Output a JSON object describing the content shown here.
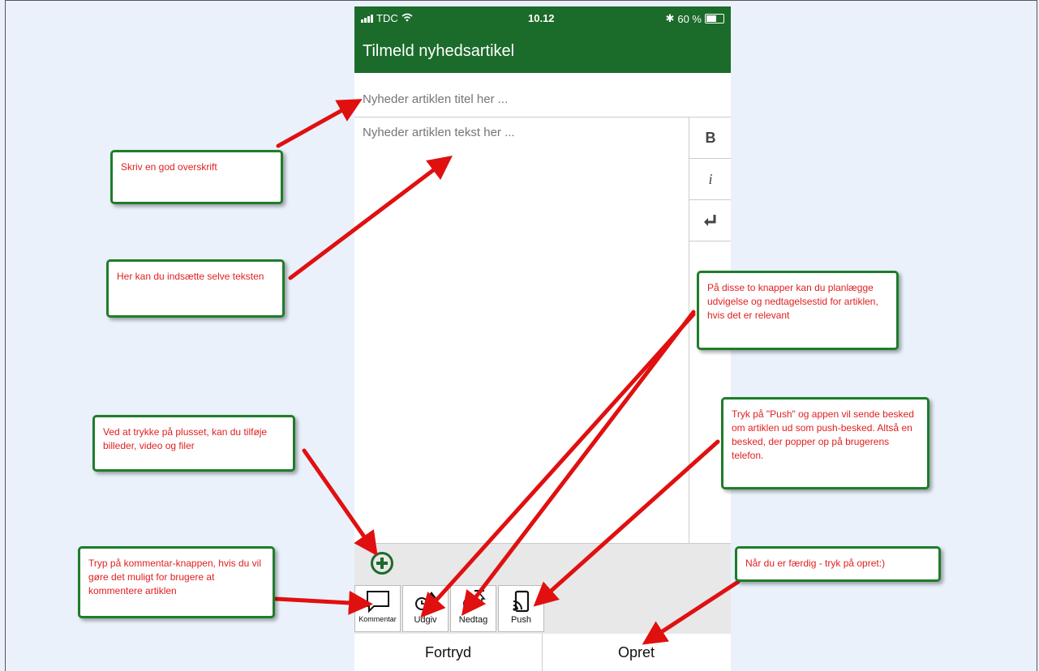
{
  "status_bar": {
    "carrier": "TDC",
    "time": "10.12",
    "battery": "60 %"
  },
  "app_bar": {
    "title": "Tilmeld nyhedsartikel"
  },
  "form": {
    "title_placeholder": "Nyheder artiklen titel her ...",
    "body_placeholder": "Nyheder artiklen tekst her ..."
  },
  "format_buttons": {
    "bold": "B",
    "italic": "i",
    "newline": "↵"
  },
  "toolbar": {
    "comment": "Kommentar",
    "publish": "Udgiv",
    "unpublish": "Nedtag",
    "push": "Push"
  },
  "footer": {
    "cancel": "Fortryd",
    "create": "Opret"
  },
  "callouts": {
    "headline": "Skriv en god overskrift",
    "text": "Her kan du indsætte selve teksten",
    "schedule": "På disse to knapper kan du planlægge udvigelse og nedtagelsestid for artiklen, hvis det er relevant",
    "attach": "Ved at trykke på plusset, kan du tilføje billeder, video og filer",
    "push": "Tryk på \"Push\" og appen vil sende besked om artiklen ud som push-besked. Altså en besked, der popper op på brugerens telefon.",
    "comment": "Tryp på kommentar-knappen, hvis du vil gøre det muligt for brugere at kommentere artiklen",
    "done": "Når du er færdig - tryk på opret:)"
  },
  "colors": {
    "brand_green": "#1b6b2a",
    "callout_border": "#1e7d2a",
    "callout_text": "#e12020",
    "arrow": "#e01010"
  }
}
